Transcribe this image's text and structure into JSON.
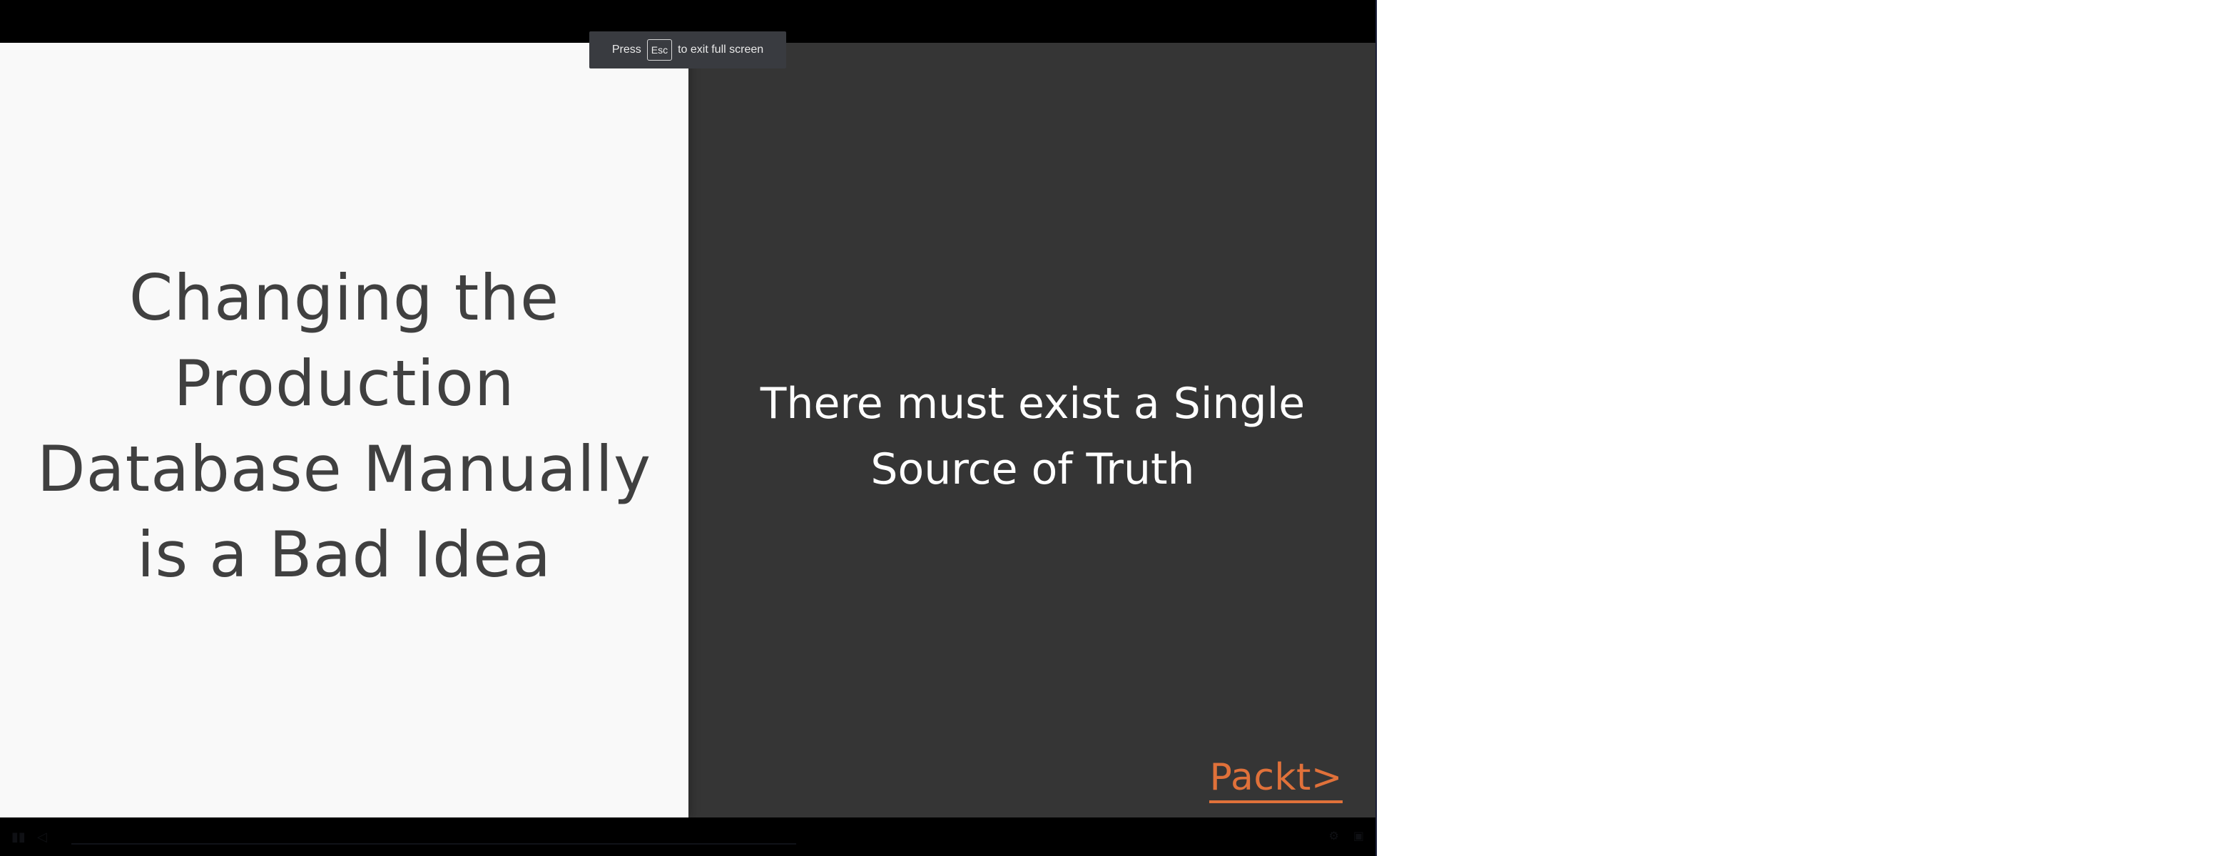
{
  "fullscreen_notice": {
    "prefix": "Press",
    "key": "Esc",
    "suffix": "to exit full screen"
  },
  "slide": {
    "left_title_lines": [
      "Changing the",
      "Production",
      "Database Manually",
      "is a Bad Idea"
    ],
    "right_statement_lines": [
      "There must exist a Single",
      "Source of Truth"
    ],
    "brand_logo": "Packt>"
  },
  "controls": {
    "play_icon": "play-icon",
    "volume_icon": "volume-icon",
    "settings_icon": "gear-icon",
    "fullscreen_icon": "exit-fullscreen-icon"
  },
  "colors": {
    "left_slide_bg": "#f9f9f9",
    "right_slide_bg": "#353535",
    "brand_orange": "#e0713a",
    "toast_bg": "#393b40"
  }
}
